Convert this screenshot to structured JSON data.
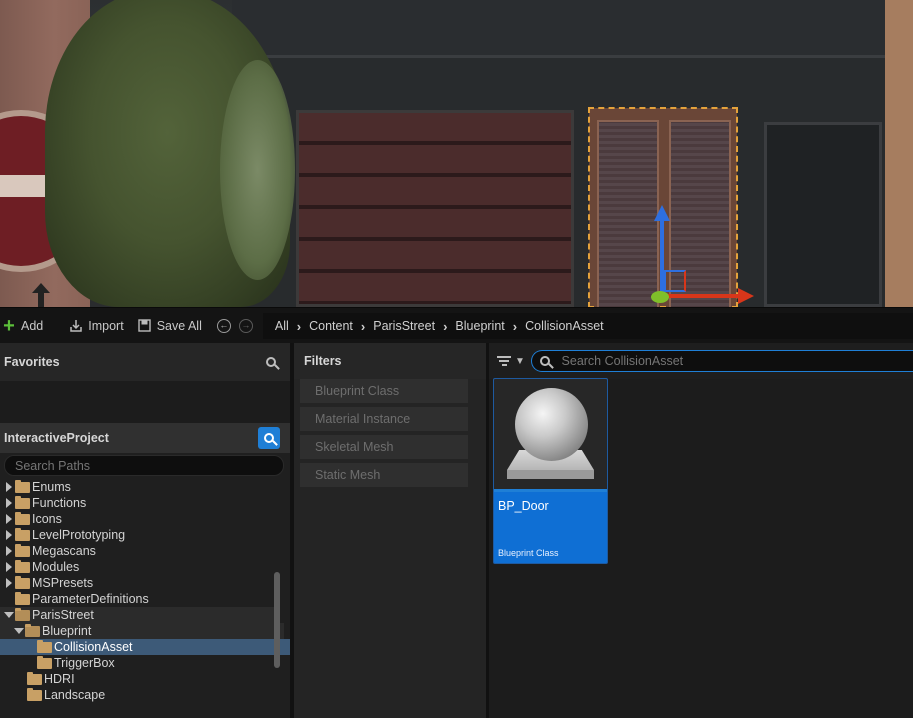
{
  "toolbar": {
    "add_label": "Add",
    "import_label": "Import",
    "save_all_label": "Save All",
    "breadcrumbs": [
      "All",
      "Content",
      "ParisStreet",
      "Blueprint",
      "CollisionAsset"
    ]
  },
  "favorites": {
    "title": "Favorites"
  },
  "project": {
    "title": "InteractiveProject",
    "search_placeholder": "Search Paths",
    "tree": [
      {
        "label": "Enums",
        "indent": 0,
        "expanded": false
      },
      {
        "label": "Functions",
        "indent": 0,
        "expanded": false
      },
      {
        "label": "Icons",
        "indent": 0,
        "expanded": false
      },
      {
        "label": "LevelPrototyping",
        "indent": 0,
        "expanded": false
      },
      {
        "label": "Megascans",
        "indent": 0,
        "expanded": false
      },
      {
        "label": "Modules",
        "indent": 0,
        "expanded": false
      },
      {
        "label": "MSPresets",
        "indent": 0,
        "expanded": false
      },
      {
        "label": "ParameterDefinitions",
        "indent": 0,
        "expanded": null
      },
      {
        "label": "ParisStreet",
        "indent": 0,
        "expanded": true
      },
      {
        "label": "Blueprint",
        "indent": 1,
        "expanded": true
      },
      {
        "label": "CollisionAsset",
        "indent": 2,
        "expanded": null,
        "selected": true
      },
      {
        "label": "TriggerBox",
        "indent": 2,
        "expanded": null
      },
      {
        "label": "HDRI",
        "indent": 1,
        "expanded": null
      },
      {
        "label": "Landscape",
        "indent": 1,
        "expanded": null
      }
    ]
  },
  "filters": {
    "title": "Filters",
    "items": [
      "Blueprint Class",
      "Material Instance",
      "Skeletal Mesh",
      "Static Mesh"
    ]
  },
  "content": {
    "search_placeholder": "Search CollisionAsset",
    "assets": [
      {
        "name": "BP_Door",
        "type": "Blueprint Class"
      }
    ]
  },
  "colors": {
    "accent": "#0f6fd4",
    "selection": "#3d5a78",
    "folder": "#c8a065",
    "add_icon": "#5cbf3a"
  },
  "icons": [
    "plus-icon",
    "import-icon",
    "save-icon",
    "back-icon",
    "forward-icon",
    "search-icon",
    "filter-icon",
    "chevron-down-icon",
    "folder-icon"
  ]
}
